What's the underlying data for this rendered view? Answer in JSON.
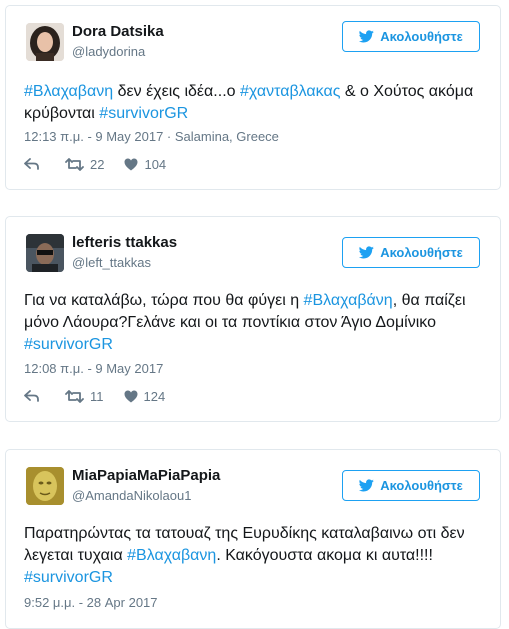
{
  "follow_label": "Ακολουθήστε",
  "tweets": [
    {
      "name": "Dora Datsika",
      "handle": "@ladydorina",
      "text": [
        {
          "t": "#Βλαχαβανη",
          "tag": true
        },
        {
          "t": " δεν έχεις ιδέα...ο ",
          "tag": false
        },
        {
          "t": "#χανταβλακας",
          "tag": true
        },
        {
          "t": " & ο Χούτος ακόμα κρύβονται ",
          "tag": false
        },
        {
          "t": "#survivorGR",
          "tag": true
        }
      ],
      "meta": "12:13 π.μ. - 9 May 2017 · Salamina, Greece",
      "retweets": "22",
      "likes": "104"
    },
    {
      "name": "lefteris ttakkas",
      "handle": "@left_ttakkas",
      "text": [
        {
          "t": "Για να καταλάβω, τώρα που θα φύγει η ",
          "tag": false
        },
        {
          "t": "#Βλαχαβάνη",
          "tag": true
        },
        {
          "t": ", θα παίζει μόνο Λάουρα?Γελάνε και οι τα ποντίκια στον Άγιο Δομίνικο ",
          "tag": false
        },
        {
          "t": "#survivorGR",
          "tag": true
        }
      ],
      "meta": "12:08 π.μ. - 9 May 2017",
      "retweets": "11",
      "likes": "124"
    },
    {
      "name": "MiaPapiaMaPiaPapia",
      "handle": "@AmandaNikolaou1",
      "text": [
        {
          "t": "Παρατηρώντας τα τατουαζ της Ευρυδίκης καταλαβαινω οτι δεν λεγεται τυχαια ",
          "tag": false
        },
        {
          "t": "#Βλαχαβανη",
          "tag": true
        },
        {
          "t": ". Κακόγουστα ακομα κι αυτα!!!! ",
          "tag": false
        },
        {
          "t": "#survivorGR",
          "tag": true
        }
      ],
      "meta": "9:52 μ.μ. - 28 Apr 2017"
    }
  ],
  "colors": {
    "accent": "#1b95e0",
    "muted": "#657786",
    "border": "#e1e8ed"
  }
}
